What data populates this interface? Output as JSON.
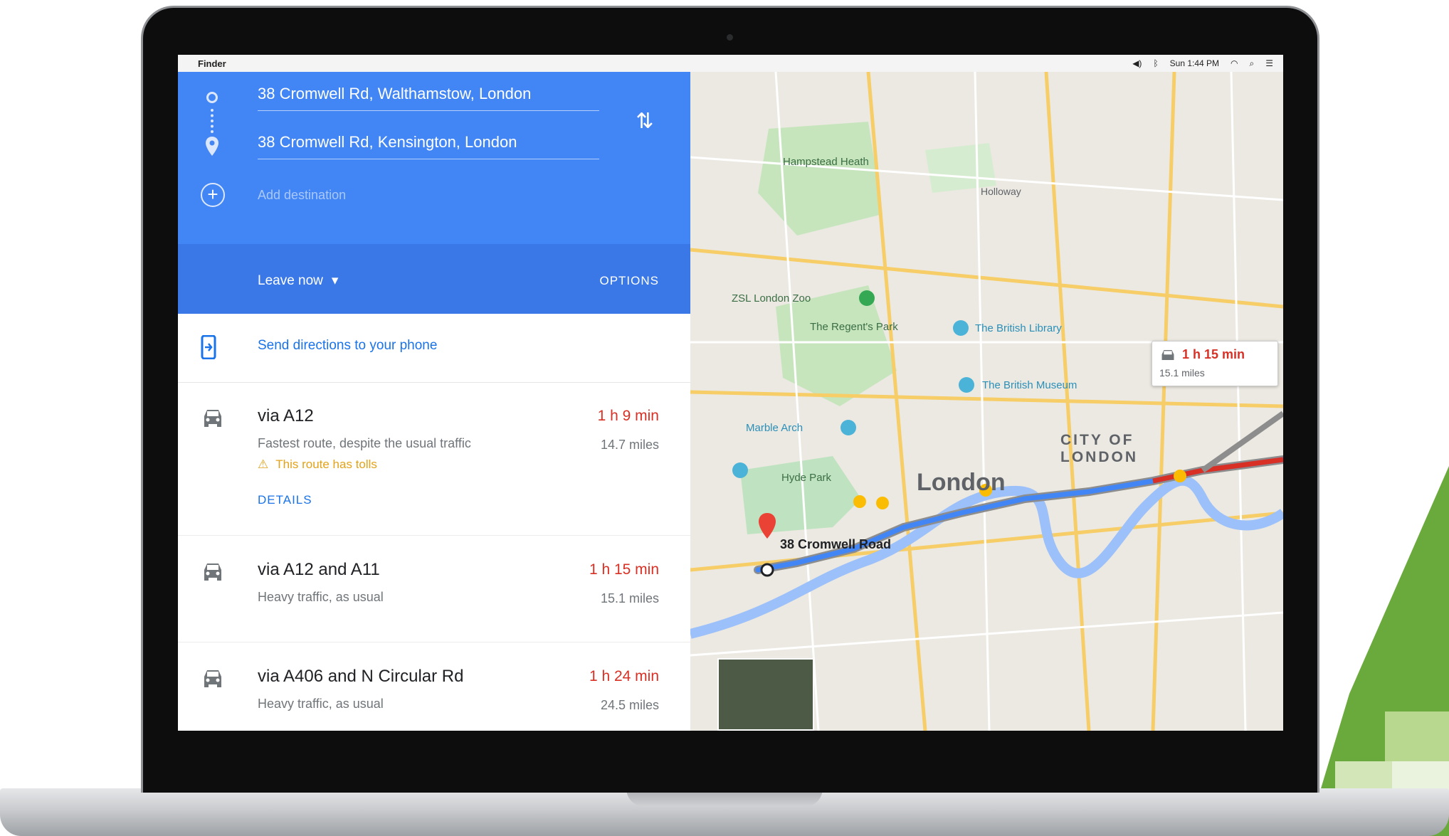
{
  "menubar": {
    "apple_glyph": "",
    "app_name": "Finder",
    "clock": "Sun 1:44 PM"
  },
  "directions": {
    "origin": "38 Cromwell Rd, Walthamstow, London",
    "destination": "38 Cromwell Rd, Kensington, London",
    "add_destination_placeholder": "Add destination",
    "leave_now": "Leave now",
    "leave_caret": "▾",
    "options_label": "OPTIONS",
    "send_to_phone": "Send directions to your phone"
  },
  "routes": [
    {
      "title": "via A12",
      "time": "1 h 9 min",
      "distance": "14.7 miles",
      "description": "Fastest route, despite the usual traffic",
      "warning": "This route has tolls",
      "details_label": "DETAILS"
    },
    {
      "title": "via A12 and A11",
      "time": "1 h 15 min",
      "distance": "15.1 miles",
      "description": "Heavy traffic, as usual"
    },
    {
      "title": "via A406 and N Circular Rd",
      "time": "1 h 24 min",
      "distance": "24.5 miles",
      "description": "Heavy traffic, as usual"
    }
  ],
  "map": {
    "labels": {
      "hampstead": "Hampstead Heath",
      "holloway": "Holloway",
      "zoo": "ZSL London Zoo",
      "regents": "The Regent's Park",
      "library": "The British Library",
      "museum": "The British Museum",
      "marble": "Marble Arch",
      "hyde": "Hyde Park",
      "city": "CITY OF LONDON",
      "london": "London",
      "dest": "38 Cromwell Road"
    },
    "callout_time": "1 h 15 min",
    "callout_distance": "15.1 miles"
  },
  "colors": {
    "primary_blue": "#4285f4",
    "dark_blue": "#3b78e7",
    "traffic_red": "#d93025",
    "link_blue": "#1a73e8",
    "deco_green": "#6aa93b"
  }
}
